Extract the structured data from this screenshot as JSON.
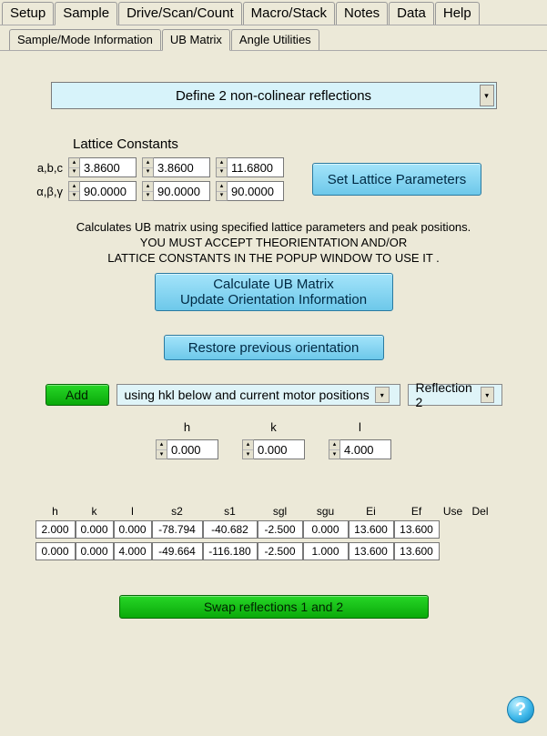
{
  "top_tabs": [
    "Setup",
    "Sample",
    "Drive/Scan/Count",
    "Macro/Stack",
    "Notes",
    "Data",
    "Help"
  ],
  "top_active": 1,
  "sub_tabs": [
    "Sample/Mode Information",
    "UB Matrix",
    "Angle Utilities"
  ],
  "sub_active": 1,
  "method_dropdown": "Define 2 non-colinear reflections",
  "lattice": {
    "title": "Lattice Constants",
    "row1_label": "a,b,c",
    "row2_label": "α,β,γ",
    "abc": [
      "3.8600",
      "3.8600",
      "11.6800"
    ],
    "angles": [
      "90.0000",
      "90.0000",
      "90.0000"
    ],
    "set_btn": "Set Lattice Parameters"
  },
  "info_lines": [
    "Calculates UB matrix using specified lattice parameters and peak positions.",
    "YOU MUST ACCEPT THEORIENTATION AND/OR",
    "LATTICE CONSTANTS IN THE POPUP WINDOW TO USE IT ."
  ],
  "calc_btn_line1": "Calculate UB Matrix",
  "calc_btn_line2": "Update Orientation Information",
  "restore_btn": "Restore previous orientation",
  "add": {
    "btn": "Add",
    "mode": "using hkl below and current motor positions",
    "refl": "Reflection 2"
  },
  "hkl": {
    "h": {
      "label": "h",
      "value": "0.000"
    },
    "k": {
      "label": "k",
      "value": "0.000"
    },
    "l": {
      "label": "l",
      "value": "4.000"
    }
  },
  "table": {
    "headers": [
      "h",
      "k",
      "l",
      "s2",
      "s1",
      "sgl",
      "sgu",
      "Ei",
      "Ef",
      "Use",
      "Del"
    ],
    "rows": [
      [
        "2.000",
        "0.000",
        "0.000",
        "-78.794",
        "-40.682",
        "-2.500",
        "0.000",
        "13.600",
        "13.600"
      ],
      [
        "0.000",
        "0.000",
        "4.000",
        "-49.664",
        "-116.180",
        "-2.500",
        "1.000",
        "13.600",
        "13.600"
      ]
    ]
  },
  "swap_btn": "Swap reflections 1 and 2",
  "help_icon": "?"
}
